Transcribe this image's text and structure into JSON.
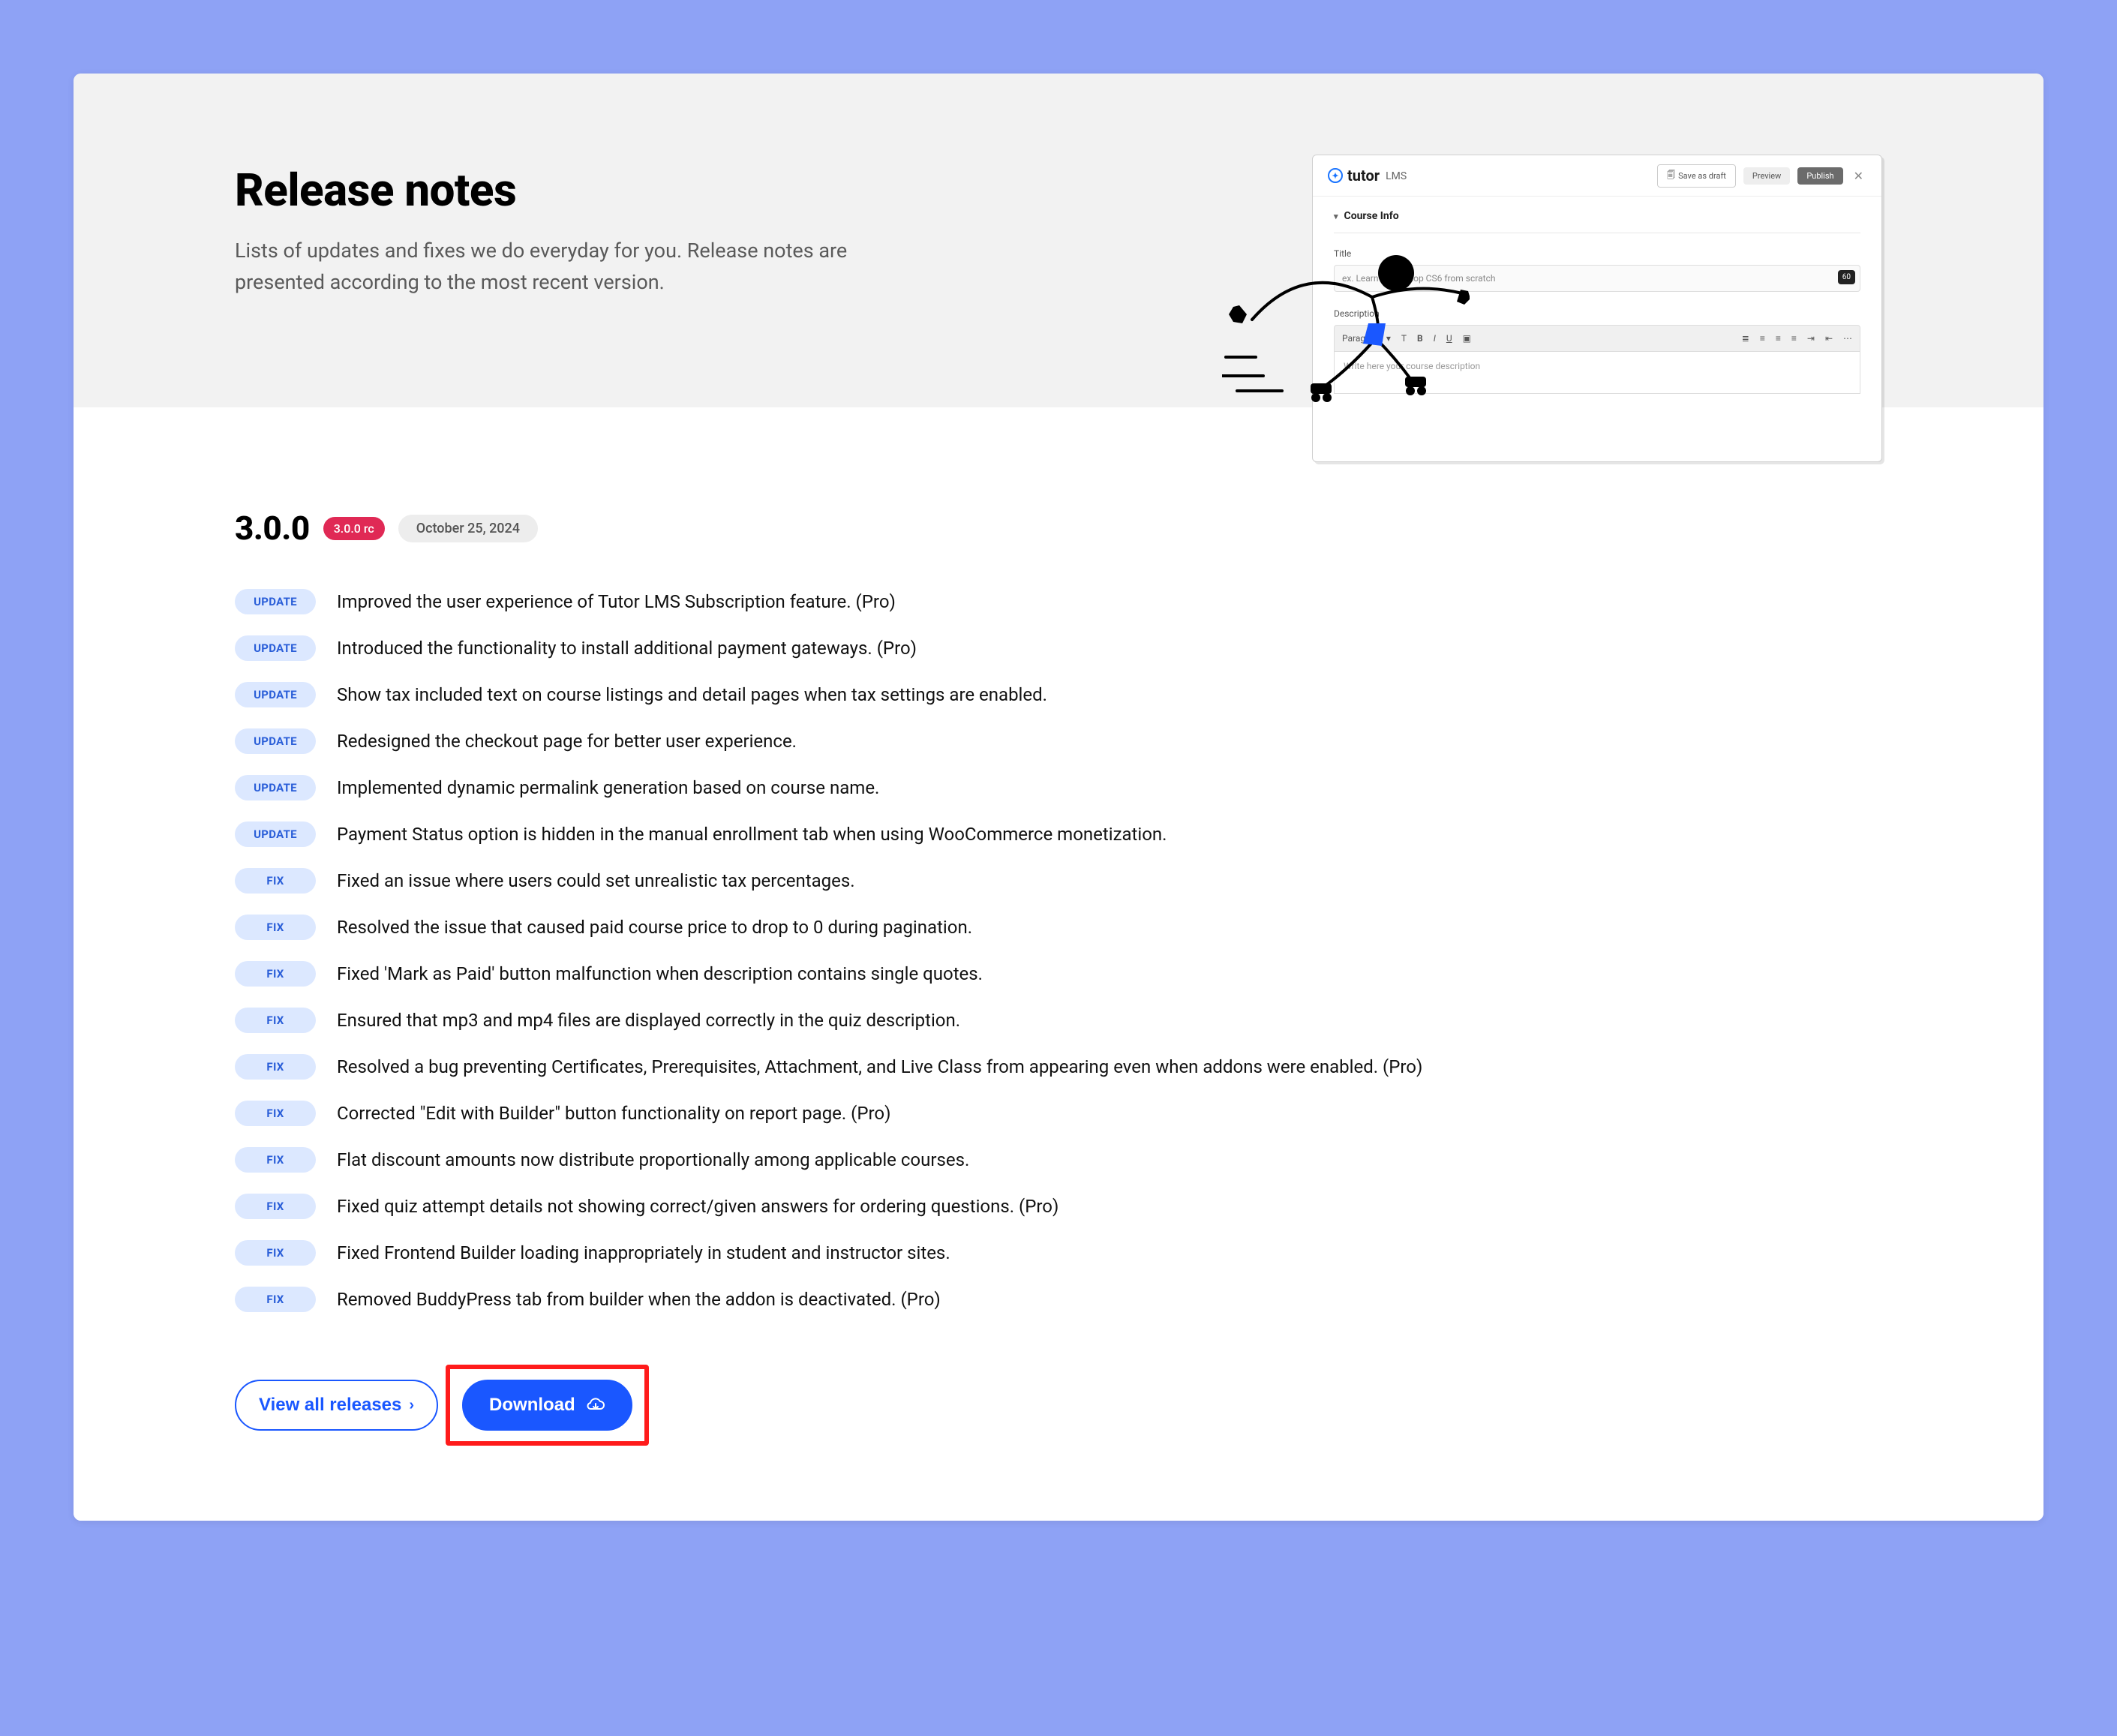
{
  "hero": {
    "title": "Release notes",
    "subtitle": "Lists of updates and fixes we do everyday for you. Release notes are presented according to the most recent version."
  },
  "mock": {
    "logo_brand": "tutor",
    "logo_suffix": "LMS",
    "btn_draft": "Save as draft",
    "btn_preview": "Preview",
    "btn_publish": "Publish",
    "section": "Course Info",
    "title_label": "Title",
    "title_placeholder": "ex. Learn photoshop CS6 from scratch",
    "title_counter": "60",
    "desc_label": "Description",
    "toolbar_select": "Paragraph",
    "editor_placeholder": "Write here your course description"
  },
  "release": {
    "version": "3.0.0",
    "rc_badge": "3.0.0 rc",
    "date": "October 25, 2024"
  },
  "labels": {
    "update": "UPDATE",
    "fix": "FIX"
  },
  "items": [
    {
      "type": "update",
      "text": "Improved the user experience of Tutor LMS Subscription feature. (Pro)"
    },
    {
      "type": "update",
      "text": "Introduced the functionality to install additional payment gateways. (Pro)"
    },
    {
      "type": "update",
      "text": "Show tax included text on course listings and detail pages when tax settings are enabled."
    },
    {
      "type": "update",
      "text": "Redesigned the checkout page for better user experience."
    },
    {
      "type": "update",
      "text": "Implemented dynamic permalink generation based on course name."
    },
    {
      "type": "update",
      "text": "Payment Status option is hidden in the manual enrollment tab when using WooCommerce monetization."
    },
    {
      "type": "fix",
      "text": "Fixed an issue where users could set unrealistic tax percentages."
    },
    {
      "type": "fix",
      "text": "Resolved the issue that caused paid course price to drop to 0 during pagination."
    },
    {
      "type": "fix",
      "text": "Fixed 'Mark as Paid' button malfunction when description contains single quotes."
    },
    {
      "type": "fix",
      "text": "Ensured that mp3 and mp4 files are displayed correctly in the quiz description."
    },
    {
      "type": "fix",
      "text": "Resolved a bug preventing Certificates, Prerequisites, Attachment, and Live Class from appearing even when addons were enabled. (Pro)"
    },
    {
      "type": "fix",
      "text": "Corrected \"Edit with Builder\" button functionality on report page. (Pro)"
    },
    {
      "type": "fix",
      "text": "Flat discount amounts now distribute proportionally among applicable courses."
    },
    {
      "type": "fix",
      "text": "Fixed quiz attempt details not showing correct/given answers for ordering questions. (Pro)"
    },
    {
      "type": "fix",
      "text": "Fixed Frontend Builder loading inappropriately in student and instructor sites."
    },
    {
      "type": "fix",
      "text": "Removed BuddyPress tab from builder when the addon is deactivated. (Pro)"
    }
  ],
  "buttons": {
    "view_all": "View all releases",
    "download": "Download"
  }
}
